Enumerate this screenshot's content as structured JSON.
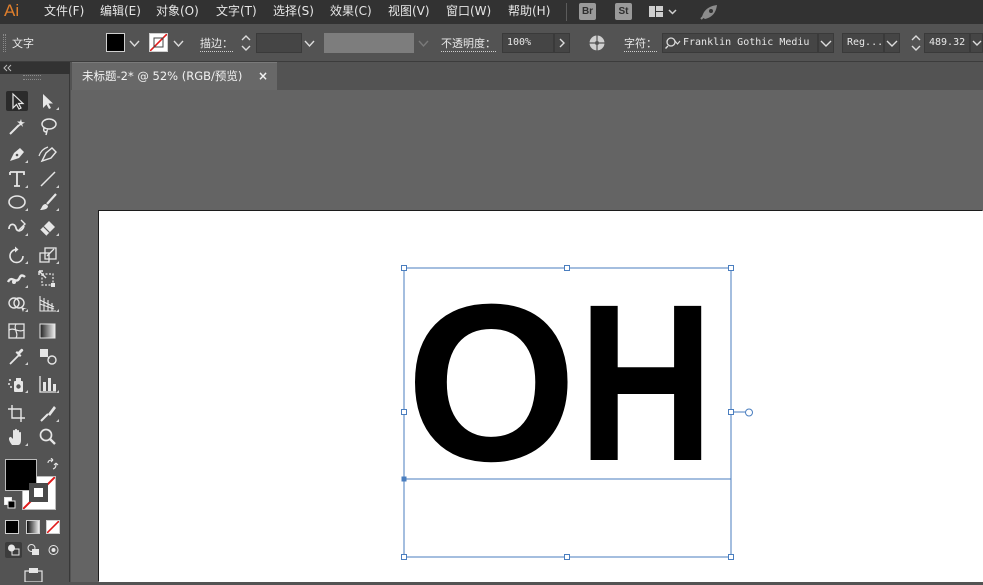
{
  "app": {
    "logo": "Ai"
  },
  "menu": {
    "items": [
      {
        "label": "文件(F)"
      },
      {
        "label": "编辑(E)"
      },
      {
        "label": "对象(O)"
      },
      {
        "label": "文字(T)"
      },
      {
        "label": "选择(S)"
      },
      {
        "label": "效果(C)"
      },
      {
        "label": "视图(V)"
      },
      {
        "label": "窗口(W)"
      },
      {
        "label": "帮助(H)"
      }
    ],
    "bridge_button": "Br",
    "stock_button": "St"
  },
  "control_bar": {
    "selection_type": "文字",
    "fill_color": "#000000",
    "stroke_label": "描边：",
    "opacity_label": "不透明度：",
    "opacity_value": "100%",
    "character_label": "字符：",
    "font_family_value": "Franklin Gothic Mediu",
    "font_style_value": "Reg...",
    "font_size_value": "489.32"
  },
  "document": {
    "tab_title": "未标题-2* @ 52% (RGB/预览)",
    "tab_close": "×",
    "text_content": [
      "O",
      "H"
    ],
    "selection_color": "#4a7ebf"
  },
  "tools": [
    "selection-tool",
    "direct-selection-tool",
    "magic-wand-tool",
    "lasso-tool",
    "pen-tool",
    "curvature-tool",
    "type-tool",
    "line-segment-tool",
    "ellipse-tool",
    "paintbrush-tool",
    "shaper-tool",
    "eraser-tool",
    "rotate-tool",
    "scale-tool",
    "width-tool",
    "free-transform-tool",
    "shape-builder-tool",
    "perspective-grid-tool",
    "mesh-tool",
    "gradient-tool",
    "eyedropper-tool",
    "blend-tool",
    "symbol-sprayer-tool",
    "column-graph-tool",
    "artboard-tool",
    "slice-tool",
    "hand-tool",
    "zoom-tool"
  ],
  "color_swatches": {
    "fill": "#000000",
    "stroke": "none"
  }
}
